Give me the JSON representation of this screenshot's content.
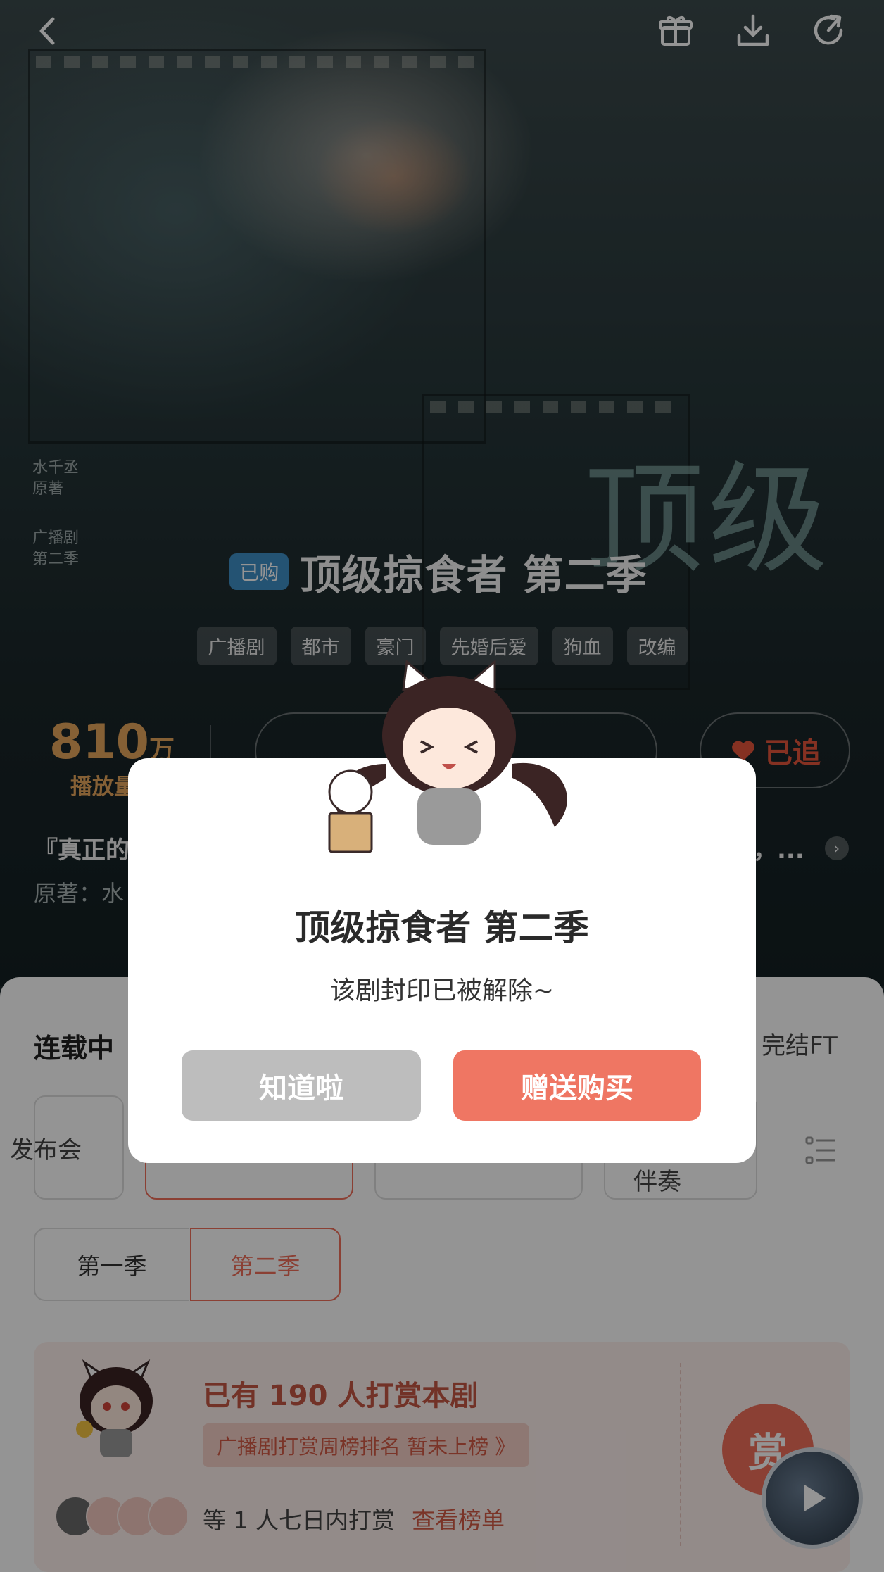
{
  "top_bar": {
    "back_icon": "back-arrow-icon",
    "gift_icon": "gift-icon",
    "download_icon": "download-icon",
    "share_icon": "share-icon"
  },
  "cover": {
    "title_art": "顶级",
    "side_text_1": "水千丞",
    "side_text_2": "原著",
    "side_text_3": "广播剧",
    "side_text_4": "第二季"
  },
  "drama": {
    "bought_badge": "已购",
    "title": "顶级掠食者 第二季",
    "tags": [
      "广播剧",
      "都市",
      "豪门",
      "先婚后爱",
      "狗血",
      "改编"
    ],
    "play_count_number": "810",
    "play_count_unit": "万",
    "play_count_label": "播放量",
    "follow_label": "已追",
    "synopsis_start": "『真正的",
    "synopsis_end": "，...",
    "author_prefix": "原著：水"
  },
  "episodes": {
    "serial_label": "连载中",
    "finale_label": "完结FT",
    "card_1": "发布会",
    "card_4": "伴奏"
  },
  "seasons": [
    "第一季",
    "第二季"
  ],
  "tip": {
    "headline": "已有 190 人打赏本剧",
    "rank_chip": "广播剧打赏周榜排名 暂未上榜 》",
    "recent": "等 1 人七日内打赏",
    "rank_link": "查看榜单",
    "reward_button": "赏"
  },
  "dialog": {
    "title": "顶级掠食者 第二季",
    "message": "该剧封印已被解除~",
    "ok_button": "知道啦",
    "buy_button": "赠送购买"
  },
  "colors": {
    "accent": "#ef7663",
    "gold": "#e6a55c",
    "badge_blue": "#3f8fc7"
  }
}
